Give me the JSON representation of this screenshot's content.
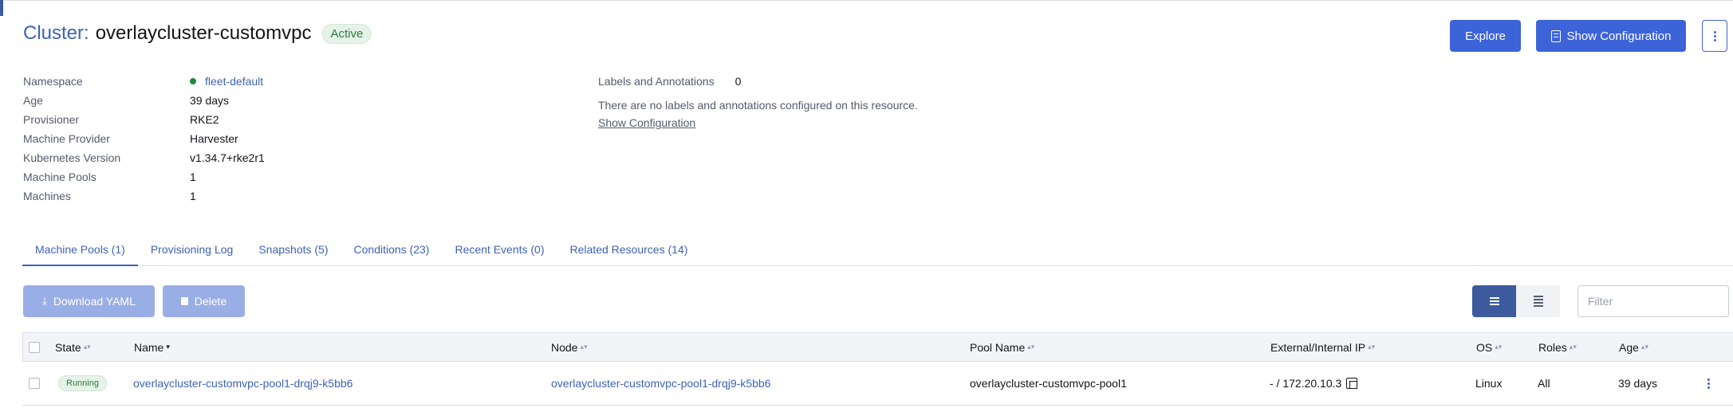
{
  "header": {
    "prefix": "Cluster:",
    "name": "overlaycluster-customvpc",
    "status": "Active",
    "explore_label": "Explore",
    "show_config_label": "Show Configuration"
  },
  "details": [
    {
      "label": "Namespace",
      "value": "fleet-default"
    },
    {
      "label": "Age",
      "value": "39 days"
    },
    {
      "label": "Provisioner",
      "value": "RKE2"
    },
    {
      "label": "Machine Provider",
      "value": "Harvester"
    },
    {
      "label": "Kubernetes Version",
      "value": "v1.34.7+rke2r1"
    },
    {
      "label": "Machine Pools",
      "value": "1"
    },
    {
      "label": "Machines",
      "value": "1"
    }
  ],
  "labels": {
    "title": "Labels and Annotations",
    "count": "0",
    "empty_text": "There are no labels and annotations configured on this resource.",
    "show_config_link": "Show Configuration"
  },
  "tabs": [
    {
      "label": "Machine Pools (1)",
      "active": true
    },
    {
      "label": "Provisioning Log",
      "active": false
    },
    {
      "label": "Snapshots (5)",
      "active": false
    },
    {
      "label": "Conditions (23)",
      "active": false
    },
    {
      "label": "Recent Events (0)",
      "active": false
    },
    {
      "label": "Related Resources (14)",
      "active": false
    }
  ],
  "toolbar": {
    "download_label": "Download YAML",
    "delete_label": "Delete",
    "filter_placeholder": "Filter"
  },
  "table": {
    "columns": {
      "state": "State",
      "name": "Name",
      "node": "Node",
      "pool_name": "Pool Name",
      "ip": "External/Internal IP",
      "os": "OS",
      "roles": "Roles",
      "age": "Age"
    },
    "rows": [
      {
        "state": "Running",
        "name": "overlaycluster-customvpc-pool1-drqj9-k5bb6",
        "node": "overlaycluster-customvpc-pool1-drqj9-k5bb6",
        "pool_name": "overlaycluster-customvpc-pool1",
        "ip": "- / 172.20.10.3",
        "os": "Linux",
        "roles": "All",
        "age": "39 days"
      }
    ]
  },
  "colors": {
    "accent": "#3d63d9",
    "link": "#3d63b3",
    "active_green": "#2c7a3f"
  }
}
